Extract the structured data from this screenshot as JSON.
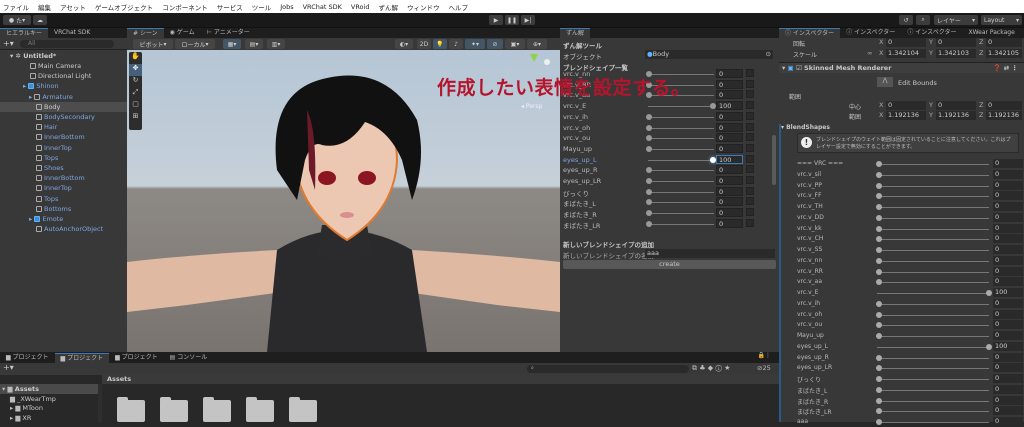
{
  "menu": [
    "ファイル",
    "編集",
    "アセット",
    "ゲームオブジェクト",
    "コンポーネント",
    "サービス",
    "ツール",
    "Jobs",
    "VRChat SDK",
    "VRoid",
    "ずん解",
    "ウィンドウ",
    "ヘルプ"
  ],
  "toolbar": {
    "account": "た",
    "layers": "レイヤー",
    "layout": "Layout"
  },
  "hierarchy": {
    "tabs": [
      "ヒエラルキー",
      "VRChat SDK"
    ],
    "search_placeholder": "All",
    "scene": "Untitled*",
    "items": [
      {
        "label": "Main Camera",
        "depth": 1,
        "blue": false
      },
      {
        "label": "Directional Light",
        "depth": 1,
        "blue": false
      },
      {
        "label": "Shinon",
        "depth": 1,
        "blue": true,
        "prefab": true
      },
      {
        "label": "Armature",
        "depth": 2,
        "blue": true
      },
      {
        "label": "Body",
        "depth": 2,
        "blue": false,
        "selected": true
      },
      {
        "label": "BodySecondary",
        "depth": 2,
        "blue": true
      },
      {
        "label": "Hair",
        "depth": 2,
        "blue": true
      },
      {
        "label": "InnerBottom",
        "depth": 2,
        "blue": true
      },
      {
        "label": "InnerTop",
        "depth": 2,
        "blue": true
      },
      {
        "label": "Tops",
        "depth": 2,
        "blue": true
      },
      {
        "label": "Shoes",
        "depth": 2,
        "blue": true
      },
      {
        "label": "InnerBottom",
        "depth": 2,
        "blue": true
      },
      {
        "label": "InnerTop",
        "depth": 2,
        "blue": true
      },
      {
        "label": "Tops",
        "depth": 2,
        "blue": true
      },
      {
        "label": "Bottoms",
        "depth": 2,
        "blue": true
      },
      {
        "label": "Emote",
        "depth": 2,
        "blue": true,
        "prefab": true
      },
      {
        "label": "AutoAnchorObject",
        "depth": 2,
        "blue": true
      }
    ]
  },
  "scene": {
    "tabs": [
      "シーン",
      "ゲーム",
      "アニメーター"
    ],
    "pivot": "ピボット",
    "local": "ローカル",
    "mode2d": "2D",
    "persp": "Persp"
  },
  "annotation": "作成したい表情を設定する。",
  "zunkai": {
    "tab": "ずん解",
    "title": "ずん解ツール",
    "object_label": "オブジェクト",
    "object_value": "Body",
    "list_title": "ブレンドシェイプ一覧",
    "rows": [
      {
        "name": "vrc.v_nn",
        "value": 0
      },
      {
        "name": "vrc.v_RR",
        "value": 0
      },
      {
        "name": "vrc.v_aa",
        "value": 0
      },
      {
        "name": "vrc.v_E",
        "value": 100
      },
      {
        "name": "vrc.v_ih",
        "value": 0
      },
      {
        "name": "vrc.v_oh",
        "value": 0
      },
      {
        "name": "vrc.v_ou",
        "value": 0
      },
      {
        "name": "Mayu_up",
        "value": 0
      },
      {
        "name": "eyes_up_L",
        "value": 100,
        "highlight": true
      },
      {
        "name": "eyes_up_R",
        "value": 0
      },
      {
        "name": "eyes_up_LR",
        "value": 0
      },
      {
        "name": "びっくり",
        "value": 0
      },
      {
        "name": "まばたき_L",
        "value": 0
      },
      {
        "name": "まばたき_R",
        "value": 0
      },
      {
        "name": "まばたき_LR",
        "value": 0
      }
    ],
    "add_title": "新しいブレンドシェイプの追加",
    "name_label": "新しいブレンドシェイプの名前",
    "name_value": "aaa",
    "create": "create"
  },
  "inspector": {
    "tabs": [
      "インスペクター",
      "インスペクター",
      "インスペクター",
      "XWear Package"
    ],
    "rotation_label": "回転",
    "rotation": [
      "0",
      "0",
      "0"
    ],
    "scale_label": "スケール",
    "scale": [
      "1.342104",
      "1.342103",
      "1.342105"
    ],
    "component": "Skinned Mesh Renderer",
    "edit_bounds": "Edit Bounds",
    "bounds_label": "範囲",
    "center_label": "中心",
    "center": [
      "0",
      "0",
      "0"
    ],
    "extent_label": "範囲",
    "extent": [
      "1.192136",
      "1.192136",
      "1.192136"
    ],
    "blendshapes_label": "BlendShapes",
    "warning": "ブレンドシェイプのウェイト範囲は固定されていることに注意してください。これはプレイヤー設定で無効にすることができます。",
    "rows": [
      {
        "name": "=== VRC ===",
        "value": 0
      },
      {
        "name": "vrc.v_sil",
        "value": 0
      },
      {
        "name": "vrc.v_PP",
        "value": 0
      },
      {
        "name": "vrc.v_FF",
        "value": 0
      },
      {
        "name": "vrc.v_TH",
        "value": 0
      },
      {
        "name": "vrc.v_DD",
        "value": 0
      },
      {
        "name": "vrc.v_kk",
        "value": 0
      },
      {
        "name": "vrc.v_CH",
        "value": 0
      },
      {
        "name": "vrc.v_SS",
        "value": 0
      },
      {
        "name": "vrc.v_nn",
        "value": 0
      },
      {
        "name": "vrc.v_RR",
        "value": 0
      },
      {
        "name": "vrc.v_aa",
        "value": 0
      },
      {
        "name": "vrc.v_E",
        "value": 100
      },
      {
        "name": "vrc.v_ih",
        "value": 0
      },
      {
        "name": "vrc.v_oh",
        "value": 0
      },
      {
        "name": "vrc.v_ou",
        "value": 0
      },
      {
        "name": "Mayu_up",
        "value": 0
      },
      {
        "name": "eyes_up_L",
        "value": 100
      },
      {
        "name": "eyes_up_R",
        "value": 0
      },
      {
        "name": "eyes_up_LR",
        "value": 0
      },
      {
        "name": "びっくり",
        "value": 0
      },
      {
        "name": "まばたき_L",
        "value": 0
      },
      {
        "name": "まばたき_R",
        "value": 0
      },
      {
        "name": "まばたき_LR",
        "value": 0
      },
      {
        "name": "aaa",
        "value": 0
      }
    ]
  },
  "project": {
    "tabs": [
      "プロジェクト",
      "プロジェクト",
      "プロジェクト",
      "コンソール"
    ],
    "tree": [
      {
        "label": "Assets",
        "depth": 0
      },
      {
        "label": "_XWearTmp",
        "depth": 1
      },
      {
        "label": "MToon",
        "depth": 1
      },
      {
        "label": "XR",
        "depth": 1
      }
    ],
    "breadcrumb": "Assets",
    "hidden_count": "25",
    "folder_count": 5
  }
}
